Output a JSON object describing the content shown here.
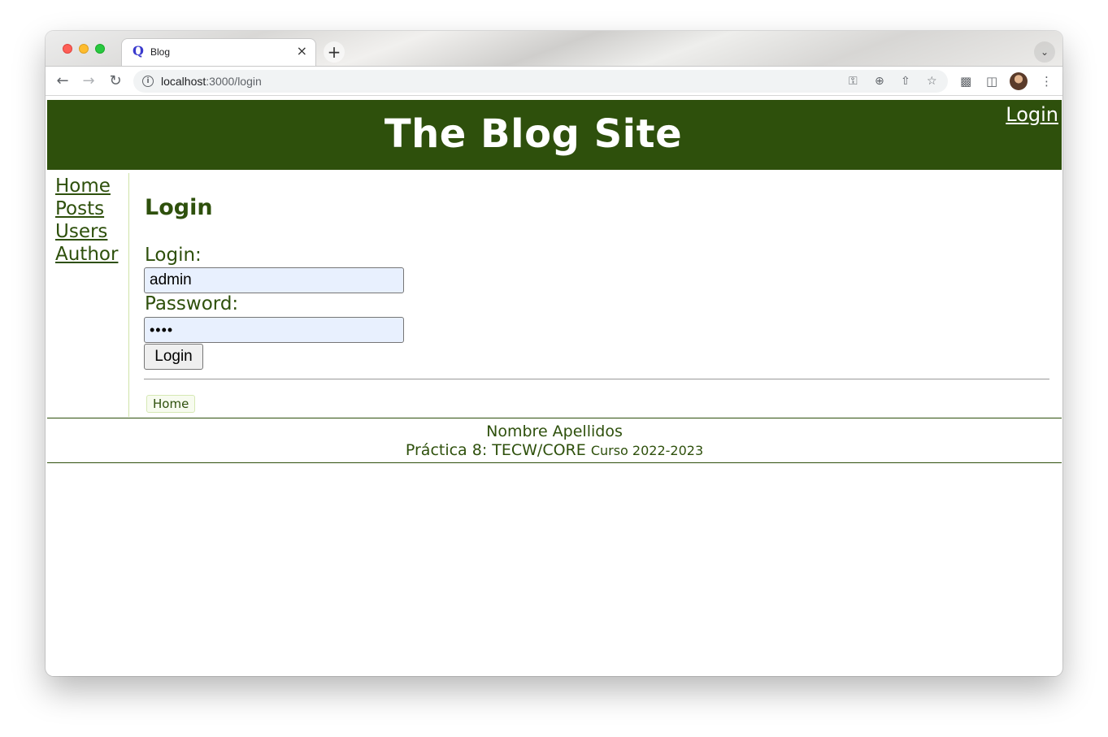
{
  "browser": {
    "tab_title": "Blog",
    "tab_favicon": "Q",
    "tab_close": "×",
    "new_tab": "+",
    "url_host": "localhost",
    "url_path": ":3000/login",
    "icons": {
      "back": "back-arrow-icon",
      "forward": "forward-arrow-icon",
      "reload": "reload-icon",
      "info": "site-info-icon",
      "key": "password-key-icon",
      "zoom": "zoom-icon",
      "share": "share-icon",
      "star": "bookmark-star-icon",
      "extensions": "puzzle-icon",
      "sidepanel": "side-panel-icon",
      "profile": "avatar",
      "menu": "kebab-menu-icon"
    }
  },
  "header": {
    "title": "The Blog Site",
    "login_link": "Login",
    "background": "#2e500c"
  },
  "sidebar": {
    "items": [
      {
        "label": "Home"
      },
      {
        "label": "Posts"
      },
      {
        "label": "Users"
      },
      {
        "label": "Author"
      }
    ]
  },
  "main": {
    "heading": "Login",
    "login_label": "Login:",
    "login_value": "admin",
    "password_label": "Password:",
    "password_value": "••••",
    "submit_label": "Login",
    "breadcrumb": "Home"
  },
  "footer": {
    "name": "Nombre Apellidos",
    "practice": "Práctica 8: TECW/CORE",
    "course": "Curso 2022-2023"
  },
  "colors": {
    "accent": "#2e500c",
    "autofill": "#e8f0fe"
  }
}
